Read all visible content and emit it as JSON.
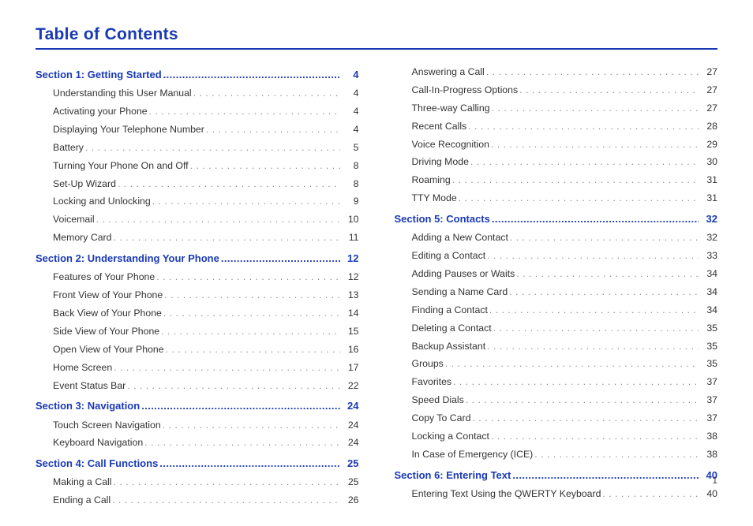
{
  "title": "Table of Contents",
  "page_number": "1",
  "columns": [
    [
      {
        "type": "section",
        "label": "Section 1:  Getting Started",
        "page": "4"
      },
      {
        "type": "sub",
        "label": "Understanding this User Manual",
        "page": "4"
      },
      {
        "type": "sub",
        "label": "Activating your Phone",
        "page": "4"
      },
      {
        "type": "sub",
        "label": "Displaying Your Telephone Number",
        "page": "4"
      },
      {
        "type": "sub",
        "label": "Battery",
        "page": "5"
      },
      {
        "type": "sub",
        "label": "Turning Your Phone On and Off",
        "page": "8"
      },
      {
        "type": "sub",
        "label": "Set-Up Wizard",
        "page": "8"
      },
      {
        "type": "sub",
        "label": "Locking and Unlocking",
        "page": "9"
      },
      {
        "type": "sub",
        "label": "Voicemail",
        "page": "10"
      },
      {
        "type": "sub",
        "label": "Memory Card",
        "page": "11"
      },
      {
        "type": "section",
        "label": "Section 2:  Understanding Your Phone",
        "page": "12"
      },
      {
        "type": "sub",
        "label": "Features of Your Phone",
        "page": "12"
      },
      {
        "type": "sub",
        "label": "Front View of Your Phone",
        "page": "13"
      },
      {
        "type": "sub",
        "label": "Back View of Your Phone",
        "page": "14"
      },
      {
        "type": "sub",
        "label": "Side View of Your Phone",
        "page": "15"
      },
      {
        "type": "sub",
        "label": "Open View of Your Phone",
        "page": "16"
      },
      {
        "type": "sub",
        "label": "Home Screen",
        "page": "17"
      },
      {
        "type": "sub",
        "label": "Event Status Bar",
        "page": "22"
      },
      {
        "type": "section",
        "label": "Section 3:  Navigation",
        "page": "24"
      },
      {
        "type": "sub",
        "label": "Touch Screen Navigation",
        "page": "24"
      },
      {
        "type": "sub",
        "label": "Keyboard Navigation",
        "page": "24"
      },
      {
        "type": "section",
        "label": "Section 4:  Call Functions",
        "page": "25"
      },
      {
        "type": "sub",
        "label": "Making a Call",
        "page": "25"
      },
      {
        "type": "sub",
        "label": "Ending a Call",
        "page": "26"
      }
    ],
    [
      {
        "type": "sub",
        "label": "Answering a Call",
        "page": "27"
      },
      {
        "type": "sub",
        "label": "Call-In-Progress Options",
        "page": "27"
      },
      {
        "type": "sub",
        "label": "Three-way Calling",
        "page": "27"
      },
      {
        "type": "sub",
        "label": "Recent Calls",
        "page": "28"
      },
      {
        "type": "sub",
        "label": "Voice Recognition",
        "page": "29"
      },
      {
        "type": "sub",
        "label": "Driving Mode",
        "page": "30"
      },
      {
        "type": "sub",
        "label": "Roaming",
        "page": "31"
      },
      {
        "type": "sub",
        "label": "TTY Mode",
        "page": "31"
      },
      {
        "type": "section",
        "label": "Section 5:  Contacts",
        "page": "32"
      },
      {
        "type": "sub",
        "label": "Adding a New Contact",
        "page": "32"
      },
      {
        "type": "sub",
        "label": "Editing a Contact",
        "page": "33"
      },
      {
        "type": "sub",
        "label": "Adding Pauses or Waits",
        "page": "34"
      },
      {
        "type": "sub",
        "label": "Sending a Name Card",
        "page": "34"
      },
      {
        "type": "sub",
        "label": "Finding a Contact",
        "page": "34"
      },
      {
        "type": "sub",
        "label": "Deleting a Contact",
        "page": "35"
      },
      {
        "type": "sub",
        "label": "Backup Assistant",
        "page": "35"
      },
      {
        "type": "sub",
        "label": "Groups",
        "page": "35"
      },
      {
        "type": "sub",
        "label": "Favorites",
        "page": "37"
      },
      {
        "type": "sub",
        "label": "Speed Dials",
        "page": "37"
      },
      {
        "type": "sub",
        "label": "Copy To Card",
        "page": "37"
      },
      {
        "type": "sub",
        "label": "Locking a Contact",
        "page": "38"
      },
      {
        "type": "sub",
        "label": "In Case of Emergency (ICE)",
        "page": "38"
      },
      {
        "type": "section",
        "label": "Section 6:  Entering Text",
        "page": "40"
      },
      {
        "type": "sub",
        "label": "Entering Text Using the QWERTY Keyboard",
        "page": "40"
      }
    ]
  ]
}
